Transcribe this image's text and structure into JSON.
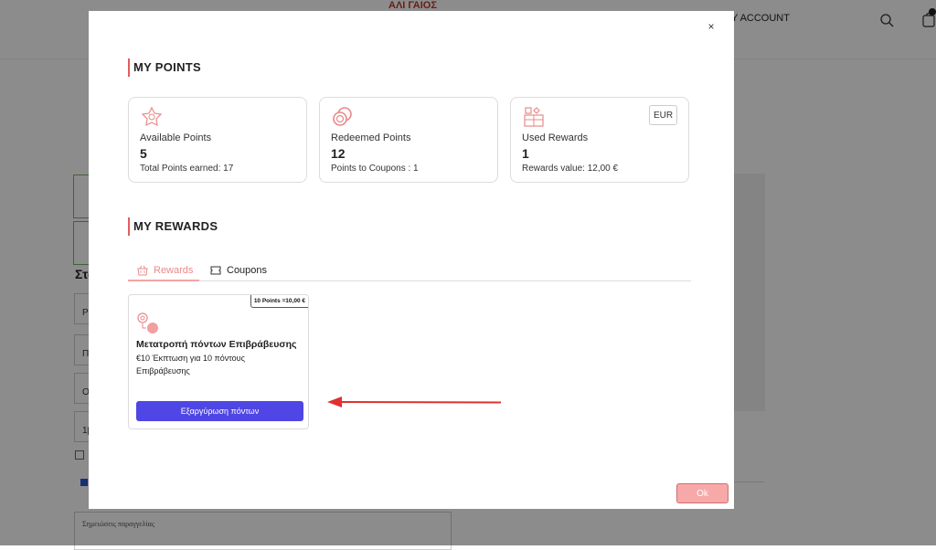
{
  "background": {
    "logo_text": "ΑΛΙ ΓΑΙΟΣ",
    "nav_account": "Y ACCOUNT",
    "heading": "Στο",
    "fields": [
      "Ρ",
      "Π",
      "Ο",
      "1β"
    ],
    "notes_placeholder": "Σημειώσεις παραγγελίας"
  },
  "modal": {
    "close_label": "×",
    "points_title": "MY POINTS",
    "cards": [
      {
        "label": "Available Points",
        "value": "5",
        "sub": "Total Points earned: 17"
      },
      {
        "label": "Redeemed Points",
        "value": "12",
        "sub": "Points to Coupons : 1"
      },
      {
        "label": "Used Rewards",
        "value": "1",
        "sub": "Rewards value: 12,00 €"
      }
    ],
    "currency": "EUR",
    "rewards_title": "MY REWARDS",
    "tabs": {
      "rewards": "Rewards",
      "coupons": "Coupons"
    },
    "reward": {
      "badge": "10 Points =10,00 €",
      "title": "Μετατροπή πόντων Επιβράβευσης",
      "description": "€10 Έκπτωση για 10 πόντους Επιβράβευσης",
      "button": "Εξαργύρωση πόντων"
    },
    "ok_label": "Ok"
  },
  "colors": {
    "accent": "#e35d5d",
    "button_primary": "#4f46e5",
    "ok_button": "#f7a8a8",
    "arrow": "#e03030"
  }
}
